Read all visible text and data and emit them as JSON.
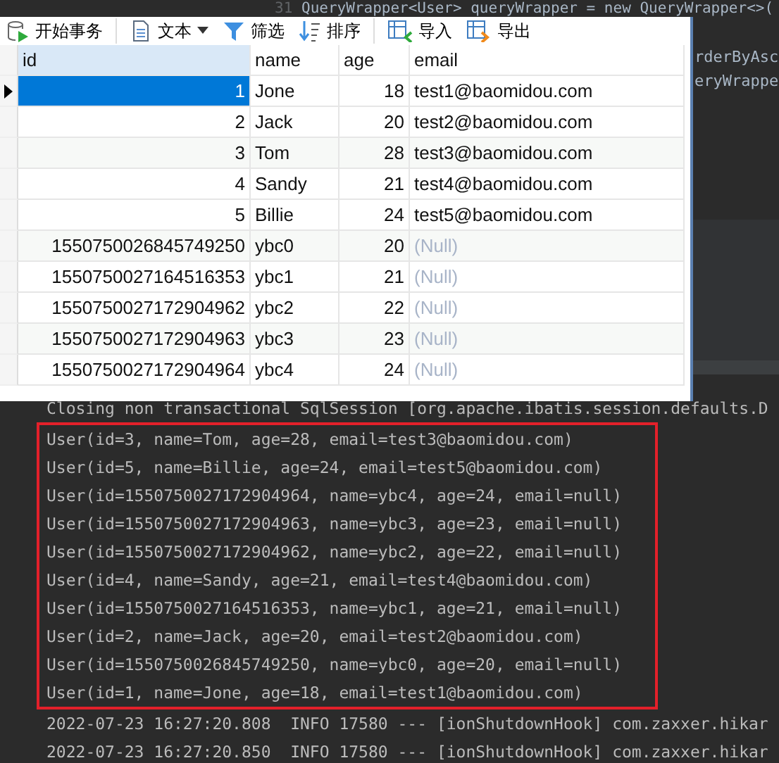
{
  "editor": {
    "line_number": "31",
    "code_lines": [
      "QueryWrapper<User> queryWrapper = new QueryWrapper<>(",
      "rderByAsc",
      "eryWrappe"
    ]
  },
  "toolbar": [
    {
      "label": "开始事务",
      "kind": "transaction"
    },
    {
      "label": "文本",
      "kind": "text"
    },
    {
      "label": "筛选",
      "kind": "filter"
    },
    {
      "label": "排序",
      "kind": "sort"
    },
    {
      "label": "导入",
      "kind": "import"
    },
    {
      "label": "导出",
      "kind": "export"
    }
  ],
  "table": {
    "columns": [
      "id",
      "name",
      "age",
      "email"
    ],
    "rows": [
      {
        "id": "1",
        "name": "Jone",
        "age": "18",
        "email": "test1@baomidou.com",
        "null_email": false,
        "selected": true
      },
      {
        "id": "2",
        "name": "Jack",
        "age": "20",
        "email": "test2@baomidou.com",
        "null_email": false,
        "selected": false
      },
      {
        "id": "3",
        "name": "Tom",
        "age": "28",
        "email": "test3@baomidou.com",
        "null_email": false,
        "selected": false
      },
      {
        "id": "4",
        "name": "Sandy",
        "age": "21",
        "email": "test4@baomidou.com",
        "null_email": false,
        "selected": false
      },
      {
        "id": "5",
        "name": "Billie",
        "age": "24",
        "email": "test5@baomidou.com",
        "null_email": false,
        "selected": false
      },
      {
        "id": "1550750026845749250",
        "name": "ybc0",
        "age": "20",
        "email": "(Null)",
        "null_email": true,
        "selected": false
      },
      {
        "id": "1550750027164516353",
        "name": "ybc1",
        "age": "21",
        "email": "(Null)",
        "null_email": true,
        "selected": false
      },
      {
        "id": "1550750027172904962",
        "name": "ybc2",
        "age": "22",
        "email": "(Null)",
        "null_email": true,
        "selected": false
      },
      {
        "id": "1550750027172904963",
        "name": "ybc3",
        "age": "23",
        "email": "(Null)",
        "null_email": true,
        "selected": false
      },
      {
        "id": "1550750027172904964",
        "name": "ybc4",
        "age": "24",
        "email": "(Null)",
        "null_email": true,
        "selected": false
      }
    ]
  },
  "console": {
    "before": [
      "Closing non transactional SqlSession [org.apache.ibatis.session.defaults.D"
    ],
    "highlighted": [
      "User(id=3, name=Tom, age=28, email=test3@baomidou.com)",
      "User(id=5, name=Billie, age=24, email=test5@baomidou.com)",
      "User(id=1550750027172904964, name=ybc4, age=24, email=null)",
      "User(id=1550750027172904963, name=ybc3, age=23, email=null)",
      "User(id=1550750027172904962, name=ybc2, age=22, email=null)",
      "User(id=4, name=Sandy, age=21, email=test4@baomidou.com)",
      "User(id=1550750027164516353, name=ybc1, age=21, email=null)",
      "User(id=2, name=Jack, age=20, email=test2@baomidou.com)",
      "User(id=1550750026845749250, name=ybc0, age=20, email=null)",
      "User(id=1, name=Jone, age=18, email=test1@baomidou.com)"
    ],
    "after": [
      "2022-07-23 16:27:20.808  INFO 17580 --- [ionShutdownHook] com.zaxxer.hikar",
      "2022-07-23 16:27:20.850  INFO 17580 --- [ionShutdownHook] com.zaxxer.hikar"
    ]
  }
}
